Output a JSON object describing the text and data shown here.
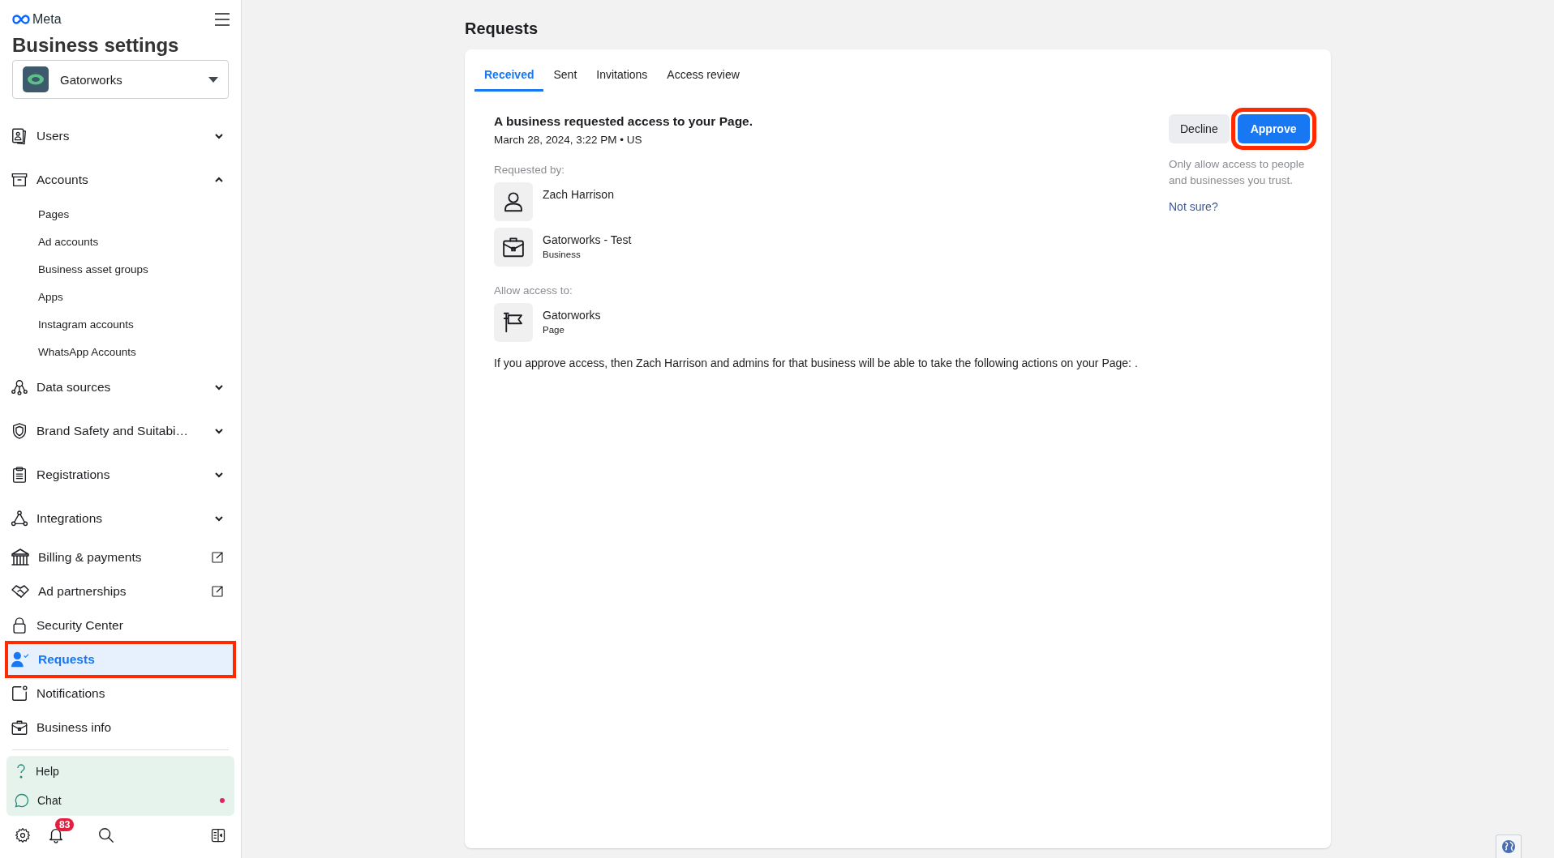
{
  "brand": {
    "logo_text": "Meta",
    "title": "Business settings"
  },
  "account_selector": {
    "name": "Gatorworks"
  },
  "nav": [
    {
      "kind": "group",
      "label": "Users",
      "expanded": false,
      "selected": false
    },
    {
      "kind": "group",
      "label": "Accounts",
      "expanded": true,
      "selected": false,
      "children": [
        {
          "label": "Pages",
          "selected": false
        },
        {
          "label": "Ad accounts",
          "selected": false
        },
        {
          "label": "Business asset groups",
          "selected": false
        },
        {
          "label": "Apps",
          "selected": false
        },
        {
          "label": "Instagram accounts",
          "selected": false
        },
        {
          "label": "WhatsApp Accounts",
          "selected": false
        }
      ]
    },
    {
      "kind": "group",
      "label": "Data sources",
      "expanded": false,
      "selected": false
    },
    {
      "kind": "group",
      "label": "Brand Safety and Suitabi…",
      "expanded": false,
      "selected": false
    },
    {
      "kind": "group",
      "label": "Registrations",
      "expanded": false,
      "selected": false
    },
    {
      "kind": "group",
      "label": "Integrations",
      "expanded": false,
      "selected": false
    },
    {
      "kind": "external",
      "label": "Billing & payments",
      "selected": false
    },
    {
      "kind": "external",
      "label": "Ad partnerships",
      "selected": false
    },
    {
      "kind": "link",
      "label": "Security Center",
      "selected": false
    },
    {
      "kind": "link",
      "label": "Requests",
      "selected": true,
      "highlighted": true
    },
    {
      "kind": "link",
      "label": "Notifications",
      "selected": false
    },
    {
      "kind": "link",
      "label": "Business info",
      "selected": false
    }
  ],
  "support": [
    {
      "label": "Help",
      "unread": false
    },
    {
      "label": "Chat",
      "unread": true
    }
  ],
  "footer": {
    "notification_count": "83"
  },
  "page": {
    "title": "Requests",
    "tabs": [
      {
        "label": "Received",
        "selected": true
      },
      {
        "label": "Sent",
        "selected": false
      },
      {
        "label": "Invitations",
        "selected": false
      },
      {
        "label": "Access review",
        "selected": false
      }
    ],
    "request": {
      "title": "A business requested access to your Page.",
      "date": "March 28, 2024, 3:22 PM • US",
      "requested_by_label": "Requested by:",
      "requesters": [
        {
          "kind": "person",
          "name": "Zach Harrison"
        },
        {
          "kind": "business",
          "name": "Gatorworks - Test",
          "subtitle": "Business"
        }
      ],
      "allow_label": "Allow access to:",
      "assets": [
        {
          "kind": "page",
          "name": "Gatorworks",
          "subtitle": "Page"
        }
      ],
      "summary": "If you approve access, then Zach Harrison and admins for that business will be able to take the following actions on your Page: .",
      "actions": [
        {
          "kind": "secondary",
          "label": "Decline",
          "highlighted": false
        },
        {
          "kind": "primary",
          "label": "Approve",
          "highlighted": true
        }
      ],
      "note": "Only allow access to people and businesses you trust.",
      "help_link": "Not sure?"
    }
  }
}
